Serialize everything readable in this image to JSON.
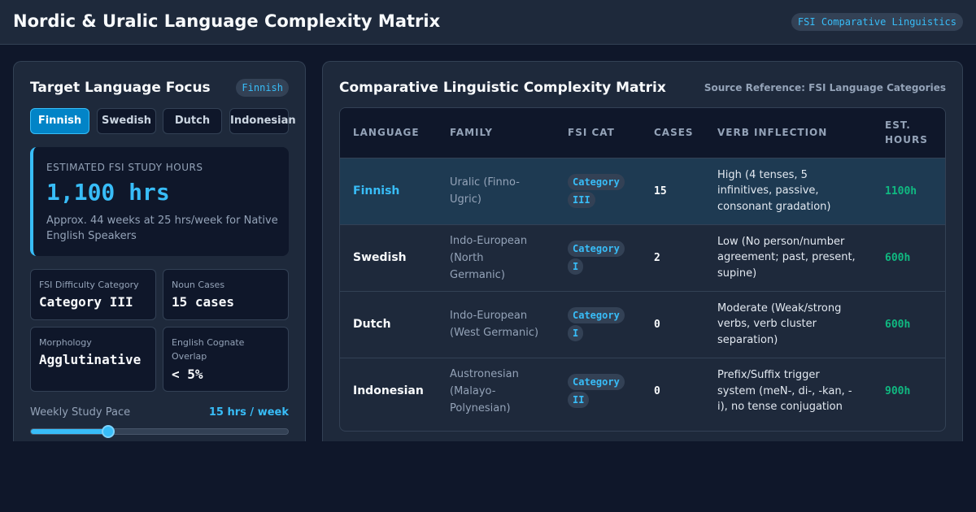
{
  "header": {
    "title": "Nordic & Uralic Language Complexity Matrix",
    "badge": "FSI Comparative Linguistics"
  },
  "focus": {
    "title": "Target Language Focus",
    "selected_badge": "Finnish",
    "tabs": [
      {
        "label": "Finnish",
        "active": true
      },
      {
        "label": "Swedish",
        "active": false
      },
      {
        "label": "Dutch",
        "active": false
      },
      {
        "label": "Indonesian",
        "active": false
      }
    ],
    "hours_card": {
      "label": "ESTIMATED FSI STUDY HOURS",
      "value": "1,100 hrs",
      "note": "Approx. 44 weeks at 25 hrs/week for Native English Speakers"
    },
    "stats": [
      {
        "label": "FSI Difficulty Category",
        "value": "Category III"
      },
      {
        "label": "Noun Cases",
        "value": "15 cases"
      },
      {
        "label": "Morphology",
        "value": "Agglutinative"
      },
      {
        "label": "English Cognate Overlap",
        "value": "< 5%"
      }
    ],
    "pace": {
      "label": "Weekly Study Pace",
      "value": "15 hrs / week",
      "slider_fraction": 0.3
    }
  },
  "matrix": {
    "title": "Comparative Linguistic Complexity Matrix",
    "source": "Source Reference: FSI Language Categories",
    "columns": [
      "LANGUAGE",
      "FAMILY",
      "FSI CAT",
      "CASES",
      "VERB INFLECTION",
      "EST. HOURS"
    ],
    "rows": [
      {
        "language": "Finnish",
        "family": "Uralic (Finno-Ugric)",
        "category": "Category III",
        "cases": "15",
        "verb": "High (4 tenses, 5 infinitives, passive, consonant gradation)",
        "hours": "1100h",
        "selected": true
      },
      {
        "language": "Swedish",
        "family": "Indo-European (North Germanic)",
        "category": "Category I",
        "cases": "2",
        "verb": "Low (No person/number agreement; past, present, supine)",
        "hours": "600h",
        "selected": false
      },
      {
        "language": "Dutch",
        "family": "Indo-European (West Germanic)",
        "category": "Category I",
        "cases": "0",
        "verb": "Moderate (Weak/strong verbs, verb cluster separation)",
        "hours": "600h",
        "selected": false
      },
      {
        "language": "Indonesian",
        "family": "Austronesian (Malayo-Polynesian)",
        "category": "Category II",
        "cases": "0",
        "verb": "Prefix/Suffix trigger system (meN-, di-, -kan, -i), no tense conjugation",
        "hours": "900h",
        "selected": false
      }
    ]
  },
  "colors": {
    "background": "#0f172a",
    "panel": "#1e293b",
    "accent": "#38bdf8",
    "active_tab": "#0284c7",
    "hours_green": "#10b981",
    "selected_row": "#1e3a52"
  }
}
